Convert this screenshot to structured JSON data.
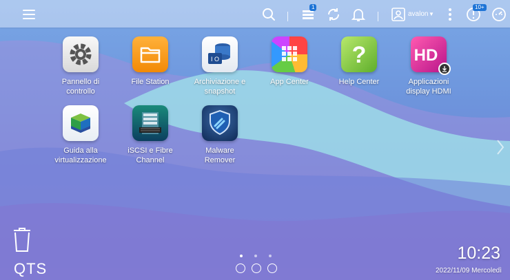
{
  "topbar": {
    "menu_icon": "hamburger-menu-icon",
    "search_icon": "search-icon",
    "tasks_badge": "1",
    "user_name": "avalon",
    "notifications_badge": "10+"
  },
  "apps": [
    {
      "id": "pannello",
      "label_lines": [
        "Pannello di",
        "controllo"
      ],
      "icon": "gear-icon"
    },
    {
      "id": "file-station",
      "label_lines": [
        "File Station"
      ],
      "icon": "folder-icon"
    },
    {
      "id": "archiviazione",
      "label_lines": [
        "Archiviazione e",
        "snapshot"
      ],
      "icon": "storage-icon"
    },
    {
      "id": "app-center",
      "label_lines": [
        "App Center"
      ],
      "icon": "app-grid-icon"
    },
    {
      "id": "help-center",
      "label_lines": [
        "Help Center"
      ],
      "icon": "question-icon"
    },
    {
      "id": "hdmi",
      "label_lines": [
        "Applicazioni",
        "display HDMI"
      ],
      "icon": "hd-icon"
    },
    {
      "id": "virtualizzazione",
      "label_lines": [
        "Guida alla",
        "virtualizzazione"
      ],
      "icon": "virtualization-cube-icon"
    },
    {
      "id": "iscsi",
      "label_lines": [
        "iSCSI e Fibre",
        "Channel"
      ],
      "icon": "server-rack-icon"
    },
    {
      "id": "malware",
      "label_lines": [
        "Malware",
        "Remover"
      ],
      "icon": "shield-icon"
    }
  ],
  "footer": {
    "brand": "QTS",
    "time": "10:23",
    "date": "2022/11/09 Mercoledì",
    "active_page": 1,
    "page_count": 3
  }
}
